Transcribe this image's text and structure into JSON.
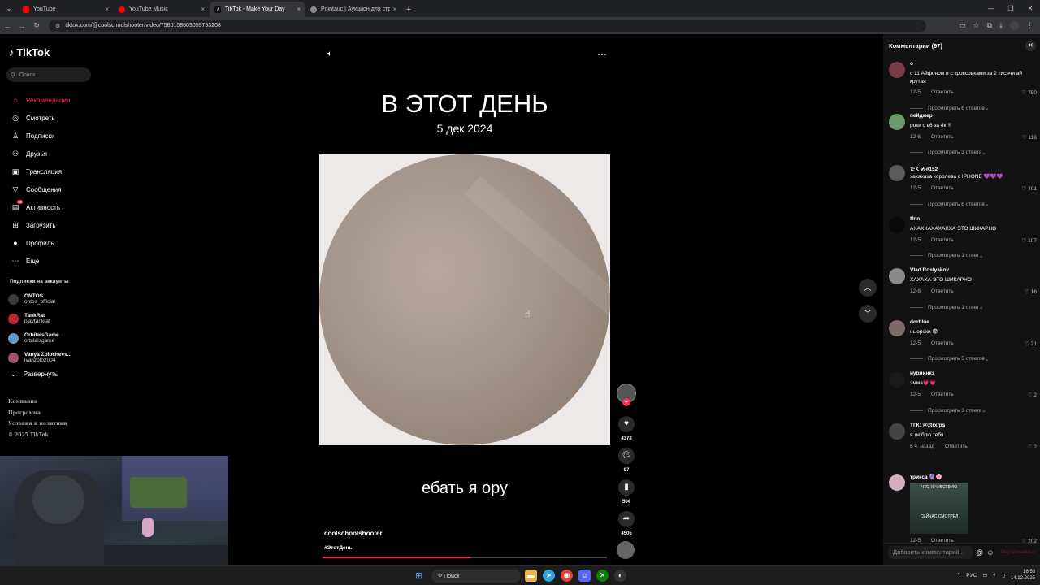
{
  "browser": {
    "tabs": [
      {
        "label": "YouTube",
        "color": "#ff0000",
        "active": false
      },
      {
        "label": "YouTube Music",
        "color": "#ff0000",
        "active": false
      },
      {
        "label": "TikTok - Make Your Day",
        "color": "#ffffff",
        "active": true
      },
      {
        "label": "Pointauc | Аукцион для стрим...",
        "color": "#8a8a8a",
        "active": false
      }
    ],
    "url": "tiktok.com/@coolschoolshooter/video/7580158603059793208"
  },
  "sidebar": {
    "logo": "TikTok",
    "search_placeholder": "Поиск",
    "nav": [
      {
        "label": "Рекомендации",
        "icon": "home-icon",
        "glyph": "⌂",
        "active": true
      },
      {
        "label": "Смотреть",
        "icon": "compass-icon",
        "glyph": "◎",
        "active": false
      },
      {
        "label": "Подписки",
        "icon": "following-icon",
        "glyph": "♙",
        "active": false
      },
      {
        "label": "Друзья",
        "icon": "friends-icon",
        "glyph": "⚇",
        "active": false
      },
      {
        "label": "Трансляция",
        "icon": "live-icon",
        "glyph": "▣",
        "active": false
      },
      {
        "label": "Сообщения",
        "icon": "messages-icon",
        "glyph": "▽",
        "active": false
      },
      {
        "label": "Активность",
        "icon": "activity-icon",
        "glyph": "▤",
        "active": false,
        "badge": "99"
      },
      {
        "label": "Загрузить",
        "icon": "upload-icon",
        "glyph": "⊞",
        "active": false
      },
      {
        "label": "Профиль",
        "icon": "profile-icon",
        "glyph": "●",
        "active": false
      },
      {
        "label": "Еще",
        "icon": "more-icon",
        "glyph": "⋯",
        "active": false
      }
    ],
    "subs_title": "Подписки на аккаунты",
    "subs": [
      {
        "name": "ONTOS",
        "handle": "ontos_official",
        "color": "#3a3a3a"
      },
      {
        "name": "TankRat",
        "handle": "playtankrat",
        "color": "#c0243a"
      },
      {
        "name": "OrbitalsGame",
        "handle": "orbitalsgame",
        "color": "#6a9ac0"
      },
      {
        "name": "Vanya Zolochevs...",
        "handle": "ivanzolo2004",
        "color": "#a05070"
      }
    ],
    "expand_label": "Развернуть",
    "footer": [
      "Компания",
      "Программа",
      "Условия и политики",
      "© 2025 TikTok"
    ]
  },
  "video": {
    "title": "В ЭТОТ ДЕНЬ",
    "date": "5 дек 2024",
    "caption": "ебать я ору",
    "author": "coolschoolshooter",
    "hashtag": "#ЭтотДень",
    "progress": 0.52
  },
  "actions": {
    "likes": "4378",
    "comments": "97",
    "saves": "504",
    "shares": "4505"
  },
  "comments_panel": {
    "title": "Комментарии (97)",
    "items": [
      {
        "user": "о",
        "text": "с 11 Айфоном и с кроссовками за 2 тисячи ай крутая",
        "date": "12-5",
        "reply": "Ответить",
        "likes": "750",
        "more": "Просмотреть 6 ответов",
        "color": "#7a3a4a"
      },
      {
        "user": "пейджер",
        "text": "роки с в6 за 4к ✌",
        "date": "12-6",
        "reply": "Ответить",
        "likes": "116",
        "more": "Просмотреть 3 ответа",
        "color": "#6a9a6a"
      },
      {
        "user": "たくみ#152",
        "text": "хахахаха королева с IPHONE 💜💜💜",
        "date": "12-5",
        "reply": "Ответить",
        "likes": "491",
        "more": "Просмотреть 6 ответов",
        "color": "#5a5a5a"
      },
      {
        "user": "ffnn",
        "text": "АХАХХАХАХАХХА ЭТО ШИКАРНО",
        "date": "12-5",
        "reply": "Ответить",
        "likes": "107",
        "more": "Просмотреть 1 ответ",
        "color": "#0a0a0a"
      },
      {
        "user": "Vlad Roslyakov",
        "text": "ХАХАХА ЭТО ШИКАРНО",
        "date": "12-6",
        "reply": "Ответить",
        "likes": "16",
        "more": "Просмотреть 1 ответ",
        "color": "#8a8a8a"
      },
      {
        "user": "dorblue",
        "text": "ныороки 😨",
        "date": "12-5",
        "reply": "Ответить",
        "likes": "21",
        "more": "Просмотреть 5 ответов",
        "color": "#7a6a6a"
      },
      {
        "user": "нублинкз",
        "text": "эмма💗💗",
        "date": "12-5",
        "reply": "Ответить",
        "likes": "2",
        "more": "Просмотреть 3 ответа",
        "color": "#1a1a1a"
      },
      {
        "user": "ТГК: @ztrxfps",
        "text": "я люблю тебя",
        "date": "6 ч. назад",
        "reply": "Ответить",
        "likes": "2",
        "more": "",
        "color": "#444444"
      },
      {
        "user": "трикса 🔮🌸",
        "text": "",
        "date": "12-5",
        "reply": "Ответить",
        "likes": "202",
        "more": "",
        "color": "#d0b0c0",
        "sticker_top": "ЧТО Я ЧУВСТВУЮ",
        "sticker_bottom": "СЕЙЧАС СМОТРЕЛ"
      }
    ],
    "input_placeholder": "Добавить комментарий...",
    "post_label": "Опубликовать"
  },
  "taskbar": {
    "search": "Поиск",
    "lang": "РУС",
    "time": "16:58",
    "date": "14.12.2025"
  }
}
